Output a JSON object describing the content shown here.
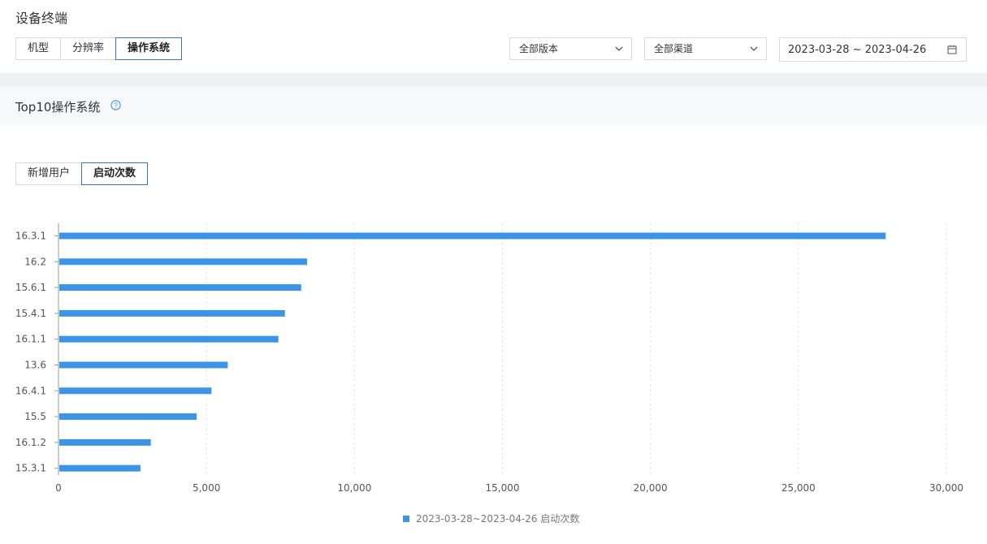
{
  "header": {
    "title": "设备终端"
  },
  "dimension_tabs": [
    {
      "label": "机型",
      "active": false
    },
    {
      "label": "分辨率",
      "active": false
    },
    {
      "label": "操作系统",
      "active": true
    }
  ],
  "filters": {
    "version": "全部版本",
    "channel": "全部渠道",
    "date_range": "2023-03-28 ~ 2023-04-26"
  },
  "section": {
    "title": "Top10操作系统"
  },
  "metric_tabs": [
    {
      "label": "新增用户",
      "active": false
    },
    {
      "label": "启动次数",
      "active": true
    }
  ],
  "colors": {
    "accent": "#3b94e8",
    "active_border": "#3c70c9"
  },
  "chart_data": {
    "type": "bar",
    "orientation": "horizontal",
    "categories": [
      "16.3.1",
      "16.2",
      "15.6.1",
      "15.4.1",
      "16.1.1",
      "13.6",
      "16.4.1",
      "15.5",
      "16.1.2",
      "15.3.1"
    ],
    "series": [
      {
        "name": "2023-03-28~2023-04-26 启动次数",
        "values": [
          27950,
          8400,
          8200,
          7650,
          7430,
          5720,
          5170,
          4670,
          3120,
          2770
        ]
      }
    ],
    "xlim": [
      0,
      30000
    ],
    "x_ticks": [
      "0",
      "5,000",
      "10,000",
      "15,000",
      "20,000",
      "25,000",
      "30,000"
    ],
    "x_tick_values": [
      0,
      5000,
      10000,
      15000,
      20000,
      25000,
      30000
    ],
    "grid": true,
    "legend": "bottom-center"
  }
}
